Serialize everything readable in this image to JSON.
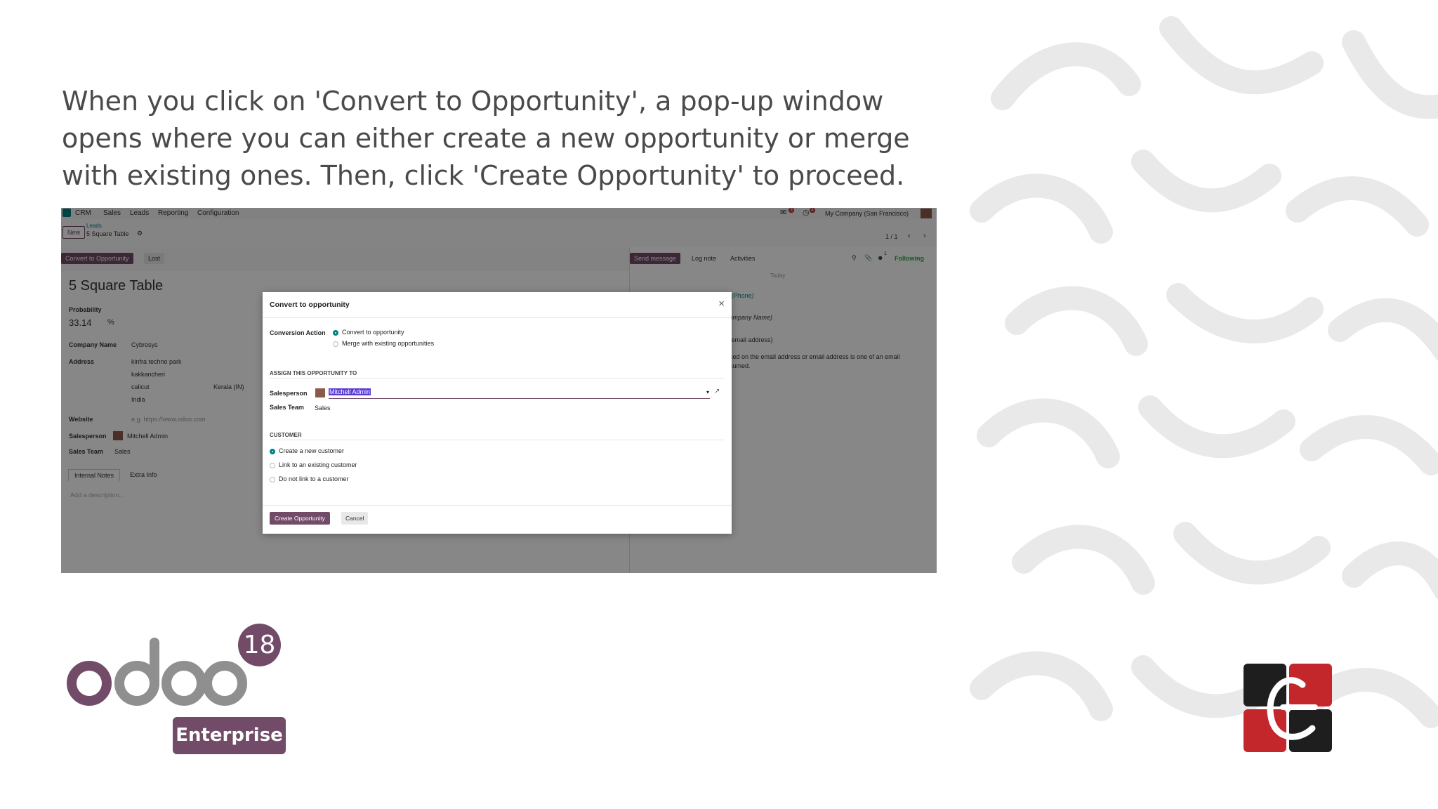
{
  "caption": "When you click on 'Convert to Opportunity', a pop-up window opens where you can either create a new opportunity or merge with existing ones. Then, click 'Create Opportunity' to proceed.",
  "nav": {
    "app": "CRM",
    "menu": [
      "Sales",
      "Leads",
      "Reporting",
      "Configuration"
    ],
    "company": "My Company (San Francisco)",
    "messages_badge": "3",
    "activity_badge": "4"
  },
  "control_panel": {
    "new_label": "New",
    "breadcrumb_parent": "Leads",
    "breadcrumb_current": "5 Square Table",
    "pager": "1 / 1"
  },
  "status_bar": {
    "convert_label": "Convert to Opportunity",
    "lost_label": "Lost"
  },
  "chatter": {
    "send_label": "Send message",
    "log_label": "Log note",
    "activities_label": "Activities",
    "following_label": "Following",
    "followers_count": "1",
    "day": "Today",
    "snippets": [
      "10 (Phone)",
      "(Company Name)",
      "on email address)",
      "based on the email address or email address is one of an email",
      "onsumed."
    ]
  },
  "form": {
    "title": "5 Square Table",
    "probability_label": "Probability",
    "probability_value": "33.14",
    "probability_unit": "%",
    "company_label": "Company Name",
    "company_value": "Cybrosys",
    "address_label": "Address",
    "street": "kinfra techno park",
    "street2": "kakkancheri",
    "city": "calicut",
    "state": "Kerala (IN)",
    "country": "India",
    "website_label": "Website",
    "website_placeholder": "e.g. https://www.odoo.com",
    "salesperson_label": "Salesperson",
    "salesperson_value": "Mitchell Admin",
    "team_label": "Sales Team",
    "team_value": "Sales",
    "tabs": [
      "Internal Notes",
      "Extra Info"
    ],
    "description_placeholder": "Add a description..."
  },
  "modal": {
    "title": "Convert to opportunity",
    "conversion_label": "Conversion Action",
    "conversion_options": [
      "Convert to opportunity",
      "Merge with existing opportunities"
    ],
    "assign_header": "ASSIGN THIS OPPORTUNITY TO",
    "salesperson_label": "Salesperson",
    "salesperson_value": "Mitchell Admin",
    "team_label": "Sales Team",
    "team_value": "Sales",
    "customer_header": "CUSTOMER",
    "customer_options": [
      "Create a new customer",
      "Link to an existing customer",
      "Do not link to a customer"
    ],
    "create_label": "Create Opportunity",
    "cancel_label": "Cancel"
  },
  "branding": {
    "odoo_wordmark": "odoo",
    "version": "18",
    "edition": "Enterprise"
  },
  "colors": {
    "primary": "#714b67",
    "teal": "#017e84",
    "logo_red": "#c3262b",
    "logo_dark": "#1e1e1e"
  }
}
